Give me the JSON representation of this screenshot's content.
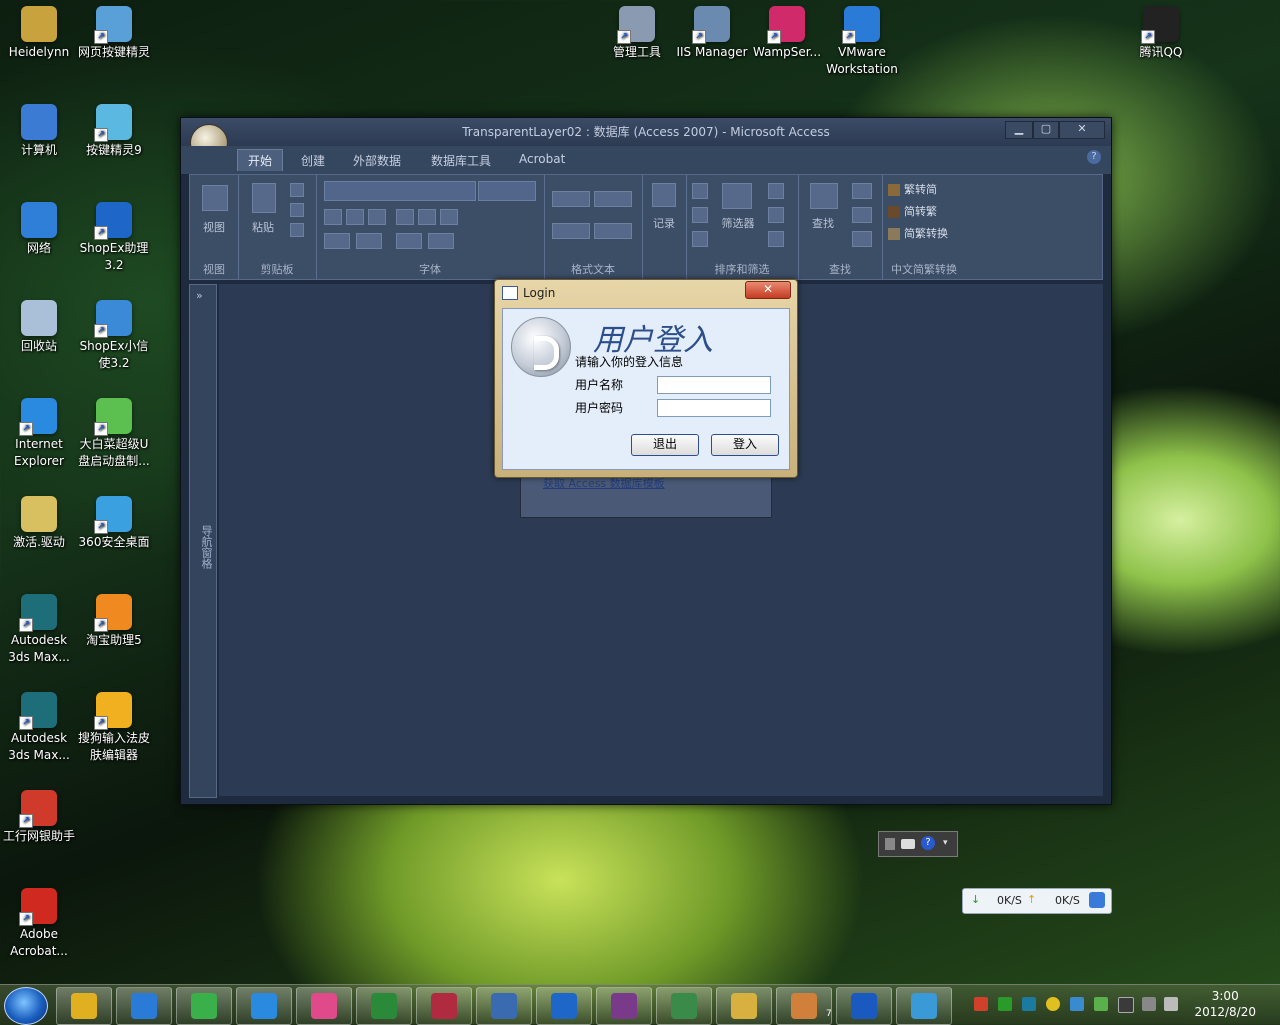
{
  "desktop_icons": [
    {
      "label": "Heidelynn",
      "color": "#c8a23c"
    },
    {
      "label": "网页按键精灵",
      "color": "#5aa0d8"
    },
    {
      "label": "计算机",
      "color": "#3b7bd4"
    },
    {
      "label": "按键精灵9",
      "color": "#5bb8e0"
    },
    {
      "label": "网络",
      "color": "#2f7ed8"
    },
    {
      "label": "ShopEx助理3.2",
      "color": "#1e66c8"
    },
    {
      "label": "回收站",
      "color": "#a9c0d8"
    },
    {
      "label": "ShopEx小信使3.2",
      "color": "#3a8ad8"
    },
    {
      "label": "Internet Explorer",
      "color": "#2a8ae0"
    },
    {
      "label": "大白菜超级U盘启动盘制...",
      "color": "#5cc050"
    },
    {
      "label": "激活.驱动",
      "color": "#d8c060"
    },
    {
      "label": "360安全桌面",
      "color": "#3aa0e0"
    },
    {
      "label": "Autodesk 3ds Max...",
      "color": "#1e6e7a"
    },
    {
      "label": "淘宝助理5",
      "color": "#f08a20"
    },
    {
      "label": "Autodesk 3ds Max...",
      "color": "#1e6e7a"
    },
    {
      "label": "搜狗输入法皮肤编辑器",
      "color": "#f0b020"
    },
    {
      "label": "工行网银助手",
      "color": "#d03a2a"
    },
    {
      "label": "Adobe Acrobat...",
      "color": "#d02a20"
    },
    {
      "label": "管理工具",
      "color": "#8a9ab0"
    },
    {
      "label": "IIS Manager",
      "color": "#6a8ab0"
    },
    {
      "label": "WampSer...",
      "color": "#d02a6a"
    },
    {
      "label": "VMware Workstation",
      "color": "#2a7ad8"
    },
    {
      "label": "腾讯QQ",
      "color": "#222222"
    }
  ],
  "access_window": {
    "title": "TransparentLayer02 : 数据库 (Access 2007) - Microsoft Access",
    "controls": {
      "minimize": "▁",
      "maximize": "▢",
      "close": "✕"
    },
    "tabs": [
      "开始",
      "创建",
      "外部数据",
      "数据库工具",
      "Acrobat"
    ],
    "help": "?",
    "ribbon": {
      "groups": [
        "视图",
        "剪贴板",
        "字体",
        "格式文本",
        "排序和筛选",
        "查找",
        "中文简繁转换"
      ],
      "buttons": {
        "view": "视图",
        "paste": "粘贴",
        "records": "记录",
        "filter": "筛选器",
        "find": "查找",
        "convert1": "繁转简",
        "convert2": "简转繁",
        "convert3": "简繁转换"
      }
    },
    "nav_pane": {
      "label": "导航窗格",
      "toggle": "»"
    },
    "background_link": "获取 Access 数据库模板"
  },
  "login": {
    "title": "Login",
    "close": "✕",
    "heading": "用户登入",
    "subtitle": "请输入你的登入信息",
    "username_label": "用户名称",
    "password_label": "用户密码",
    "username_value": "",
    "password_value": "",
    "cancel": "退出",
    "submit": "登入"
  },
  "net_speed": {
    "down": "0K/S",
    "up": "0K/S"
  },
  "taskbar": {
    "apps": [
      "Windows Media Center",
      "IE Browser",
      "Media Player",
      "Internet Explorer",
      "Picasa",
      "Excel",
      "Access",
      "Tool",
      "ShopEx助理",
      "WinRAR",
      "Computer",
      "Explorer",
      "Paint",
      "Help",
      "Bird"
    ],
    "badge_count": "7",
    "time": "3:00",
    "date": "2012/8/20"
  }
}
